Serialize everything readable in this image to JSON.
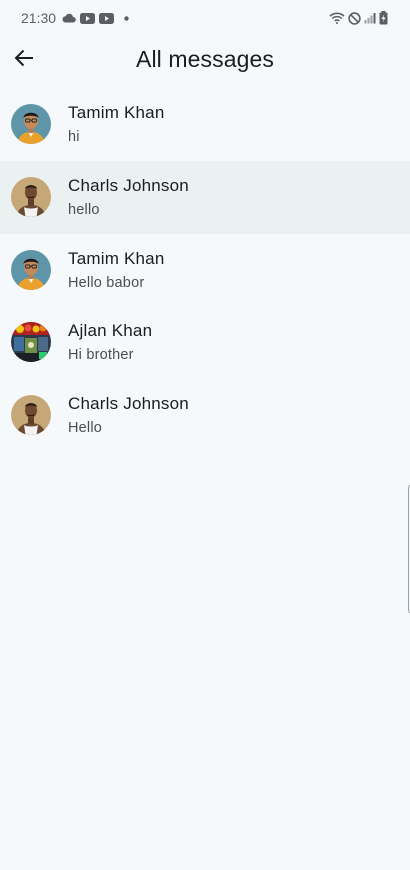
{
  "status_bar": {
    "time": "21:30",
    "left_icons": [
      "cloud-icon",
      "youtube-icon",
      "youtube-icon",
      "dot-icon"
    ],
    "right_icons": [
      "wifi-icon",
      "do-not-disturb-icon",
      "signal-icon",
      "battery-charging-icon"
    ]
  },
  "app_bar": {
    "back_icon": "arrow-left-icon",
    "title": "All messages"
  },
  "messages": [
    {
      "name": "Tamim Khan",
      "preview": "hi",
      "avatar": "avatar-tamim"
    },
    {
      "name": "Charls Johnson",
      "preview": "hello",
      "avatar": "avatar-charls",
      "selected": true
    },
    {
      "name": "Tamim Khan",
      "preview": "Hello babor",
      "avatar": "avatar-tamim"
    },
    {
      "name": "Ajlan Khan",
      "preview": "Hi brother",
      "avatar": "avatar-ajlan"
    },
    {
      "name": "Charls Johnson",
      "preview": "Hello",
      "avatar": "avatar-charls"
    }
  ],
  "colors": {
    "background": "#f6f9fb",
    "selected_row": "#ebf0f1",
    "text_primary": "#1b1d1f",
    "text_secondary": "#4a4e52"
  }
}
